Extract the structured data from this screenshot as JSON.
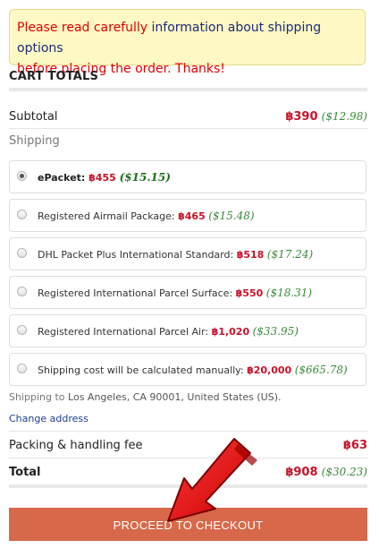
{
  "notice": {
    "part1": "Please read carefully ",
    "part2": "information about shipping options",
    "part3": "before placing the order. Thanks!"
  },
  "cart": {
    "title": "CART TOTALS",
    "subtotal_label": "Subtotal",
    "subtotal_price": "฿390",
    "subtotal_usd": "($12.98)",
    "shipping_label": "Shipping",
    "options": [
      {
        "label": "ePacket:",
        "price": "฿455",
        "usd": "($15.15)",
        "selected": true
      },
      {
        "label": "Registered Airmail Package:",
        "price": "฿465",
        "usd": "($15.48)",
        "selected": false
      },
      {
        "label": "DHL Packet Plus International Standard:",
        "price": "฿518",
        "usd": "($17.24)",
        "selected": false
      },
      {
        "label": "Registered International Parcel Surface:",
        "price": "฿550",
        "usd": "($18.31)",
        "selected": false
      },
      {
        "label": "Registered International Parcel Air:",
        "price": "฿1,020",
        "usd": "($33.95)",
        "selected": false
      },
      {
        "label": "Shipping cost will be calculated manually:",
        "price": "฿20,000",
        "usd": "($665.78)",
        "selected": false
      }
    ],
    "ship_to_prefix": "Shipping to ",
    "ship_to_dest": "Los Angeles, CA 90001, United States (US).",
    "change_address": "Change address",
    "handling_label": "Packing & handling fee",
    "handling_price": "฿63",
    "total_label": "Total",
    "total_price": "฿908",
    "total_usd": "($30.23)",
    "checkout_label": "PROCEED TO CHECKOUT"
  },
  "colors": {
    "accent": "#d7694a",
    "price_red": "#c7122a",
    "price_green": "#3a8a3a",
    "notice_bg": "#fdf8c4",
    "arrow_red": "#e8101a"
  }
}
